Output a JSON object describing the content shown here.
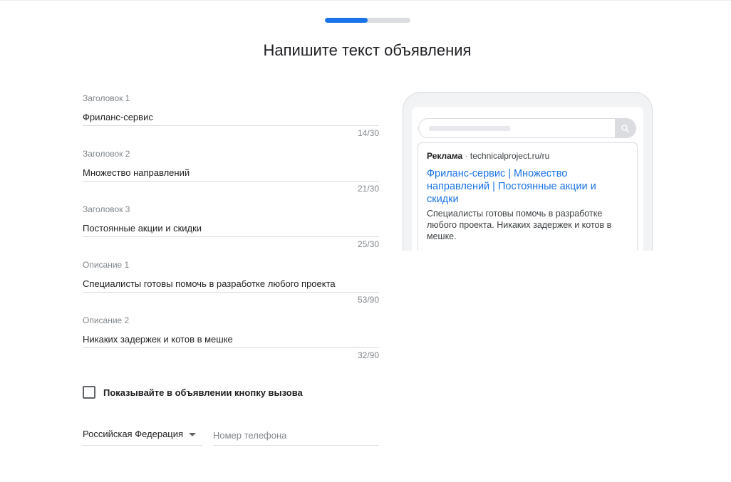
{
  "progress": {
    "value_percent": 50
  },
  "page_title": "Напишите текст объявления",
  "fields": [
    {
      "label": "Заголовок 1",
      "value": "Фриланс-сервис",
      "counter": "14/30"
    },
    {
      "label": "Заголовок 2",
      "value": "Множество направлений",
      "counter": "21/30"
    },
    {
      "label": "Заголовок 3",
      "value": "Постоянные акции и скидки",
      "counter": "25/30"
    },
    {
      "label": "Описание 1",
      "value": "Специалисты готовы помочь в разработке любого проекта",
      "counter": "53/90"
    },
    {
      "label": "Описание 2",
      "value": "Никаких задержек и котов в мешке",
      "counter": "32/90"
    }
  ],
  "call_button": {
    "label": "Показывайте в объявлении кнопку вызова",
    "checked": false
  },
  "country": {
    "value": "Российская Федерация"
  },
  "phone": {
    "placeholder": "Номер телефона",
    "value": ""
  },
  "preview": {
    "ad_badge": "Реклама",
    "separator": "·",
    "display_url": "technicalproject.ru/ru",
    "headline": "Фриланс-сервис | Множество направлений | Постоянные акции и скидки",
    "description": "Специалисты готовы помочь в разработке любого проекта. Никаких задержек и котов в мешке."
  },
  "colors": {
    "accent": "#1a73e8",
    "track": "#dadce0",
    "text": "#202124",
    "muted": "#80868b"
  },
  "icons": {
    "search_button": "search-icon",
    "country_dropdown": "arrow-drop-down-icon"
  }
}
